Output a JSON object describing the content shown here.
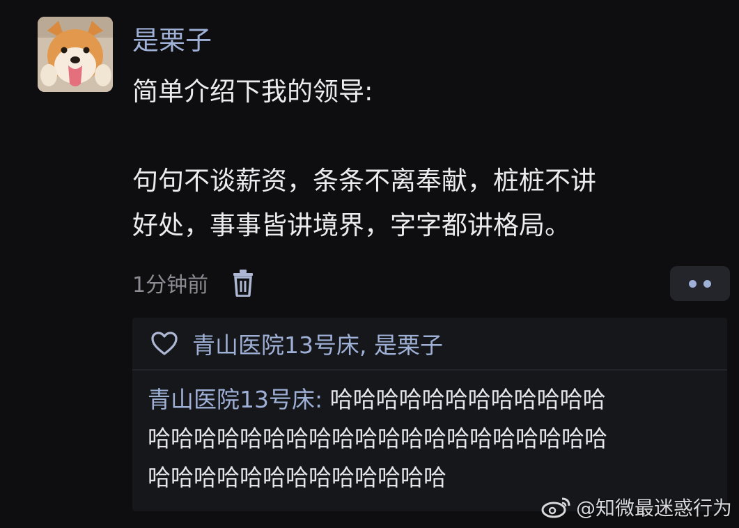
{
  "post": {
    "username": "是栗子",
    "lines": [
      "简单介绍下我的领导:",
      "句句不谈薪资，条条不离奉献，桩桩不讲",
      "好处，事事皆讲境界，字字都讲格局。"
    ],
    "timestamp": "1分钟前"
  },
  "likes": {
    "names": "青山医院13号床, 是栗子"
  },
  "reply": {
    "author": "青山医院13号床:",
    "lines": [
      "哈哈哈哈哈哈哈哈哈哈哈哈",
      "哈哈哈哈哈哈哈哈哈哈哈哈哈哈哈哈哈哈哈哈",
      "哈哈哈哈哈哈哈哈哈哈哈哈哈"
    ]
  },
  "watermark": {
    "text": "@知微最迷惑行为"
  },
  "colors": {
    "background": "#0e0e10",
    "accent": "#9fb0d6",
    "comment_bg": "#16171b"
  },
  "icons": {
    "delete": "trash-icon",
    "more": "more-dots-icon",
    "like": "heart-icon"
  }
}
